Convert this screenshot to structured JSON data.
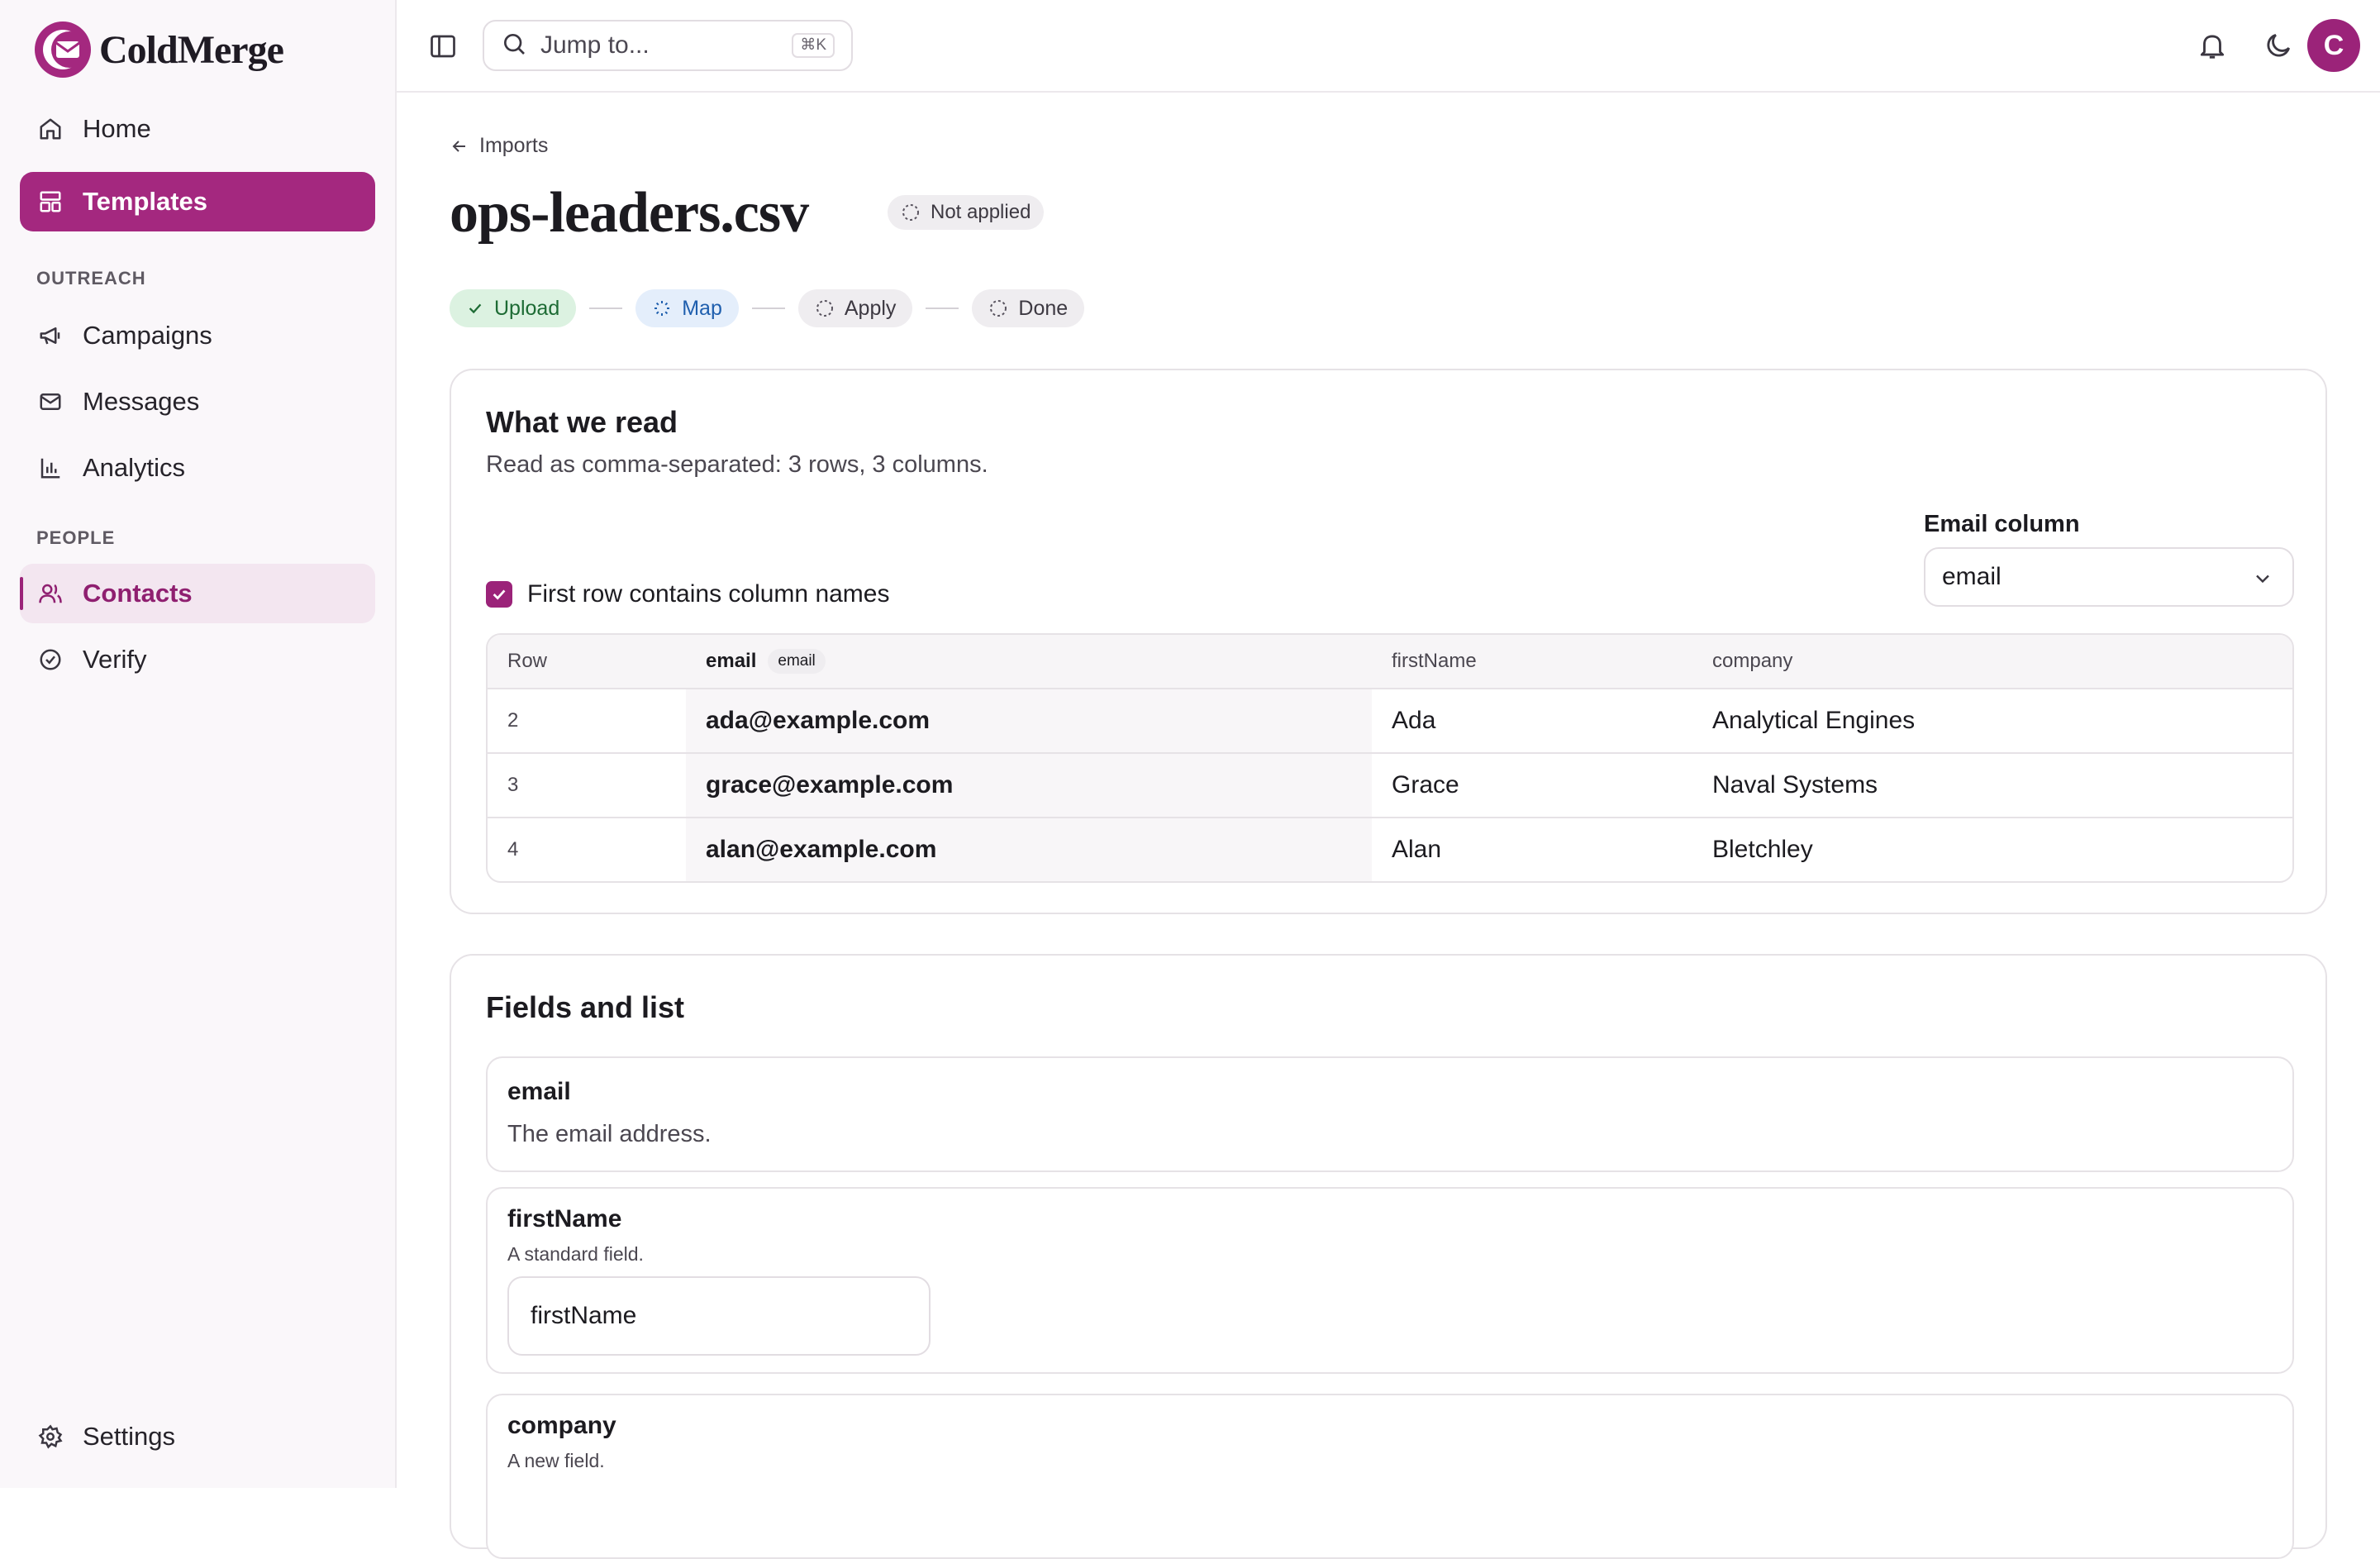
{
  "app": {
    "name": "ColdMerge"
  },
  "sidebar": {
    "items": [
      {
        "label": "Home"
      },
      {
        "label": "Templates"
      },
      {
        "label": "Campaigns"
      },
      {
        "label": "Messages"
      },
      {
        "label": "Analytics"
      },
      {
        "label": "Contacts"
      },
      {
        "label": "Verify"
      },
      {
        "label": "Settings"
      }
    ],
    "sections": {
      "outreach": "OUTREACH",
      "people": "PEOPLE"
    }
  },
  "topbar": {
    "search_placeholder": "Jump to...",
    "shortcut": "⌘K",
    "avatar_initial": "C"
  },
  "page": {
    "back_label": "Imports",
    "title": "ops-leaders.csv",
    "status": "Not applied",
    "steps": [
      {
        "label": "Upload",
        "state": "done"
      },
      {
        "label": "Map",
        "state": "active"
      },
      {
        "label": "Apply",
        "state": "pending"
      },
      {
        "label": "Done",
        "state": "pending"
      }
    ]
  },
  "read_card": {
    "title": "What we read",
    "subtitle": "Read as comma-separated: 3 rows, 3 columns.",
    "email_column_label": "Email column",
    "email_column_value": "email",
    "first_row_label": "First row contains column names",
    "first_row_checked": true,
    "table": {
      "headers": {
        "row": "Row",
        "email": "email",
        "email_tag": "email",
        "firstName": "firstName",
        "company": "company"
      },
      "rows": [
        {
          "row": "2",
          "email": "ada@example.com",
          "firstName": "Ada",
          "company": "Analytical Engines"
        },
        {
          "row": "3",
          "email": "grace@example.com",
          "firstName": "Grace",
          "company": "Naval Systems"
        },
        {
          "row": "4",
          "email": "alan@example.com",
          "firstName": "Alan",
          "company": "Bletchley"
        }
      ]
    }
  },
  "fields_card": {
    "title": "Fields and list",
    "fields": [
      {
        "name": "email",
        "description": "The email address."
      },
      {
        "name": "firstName",
        "description": "A standard field.",
        "value": "firstName"
      },
      {
        "name": "company",
        "description": "A new field."
      }
    ]
  },
  "colors": {
    "accent": "#9b2379",
    "success": "#1d6b34",
    "info": "#1f5fae"
  }
}
